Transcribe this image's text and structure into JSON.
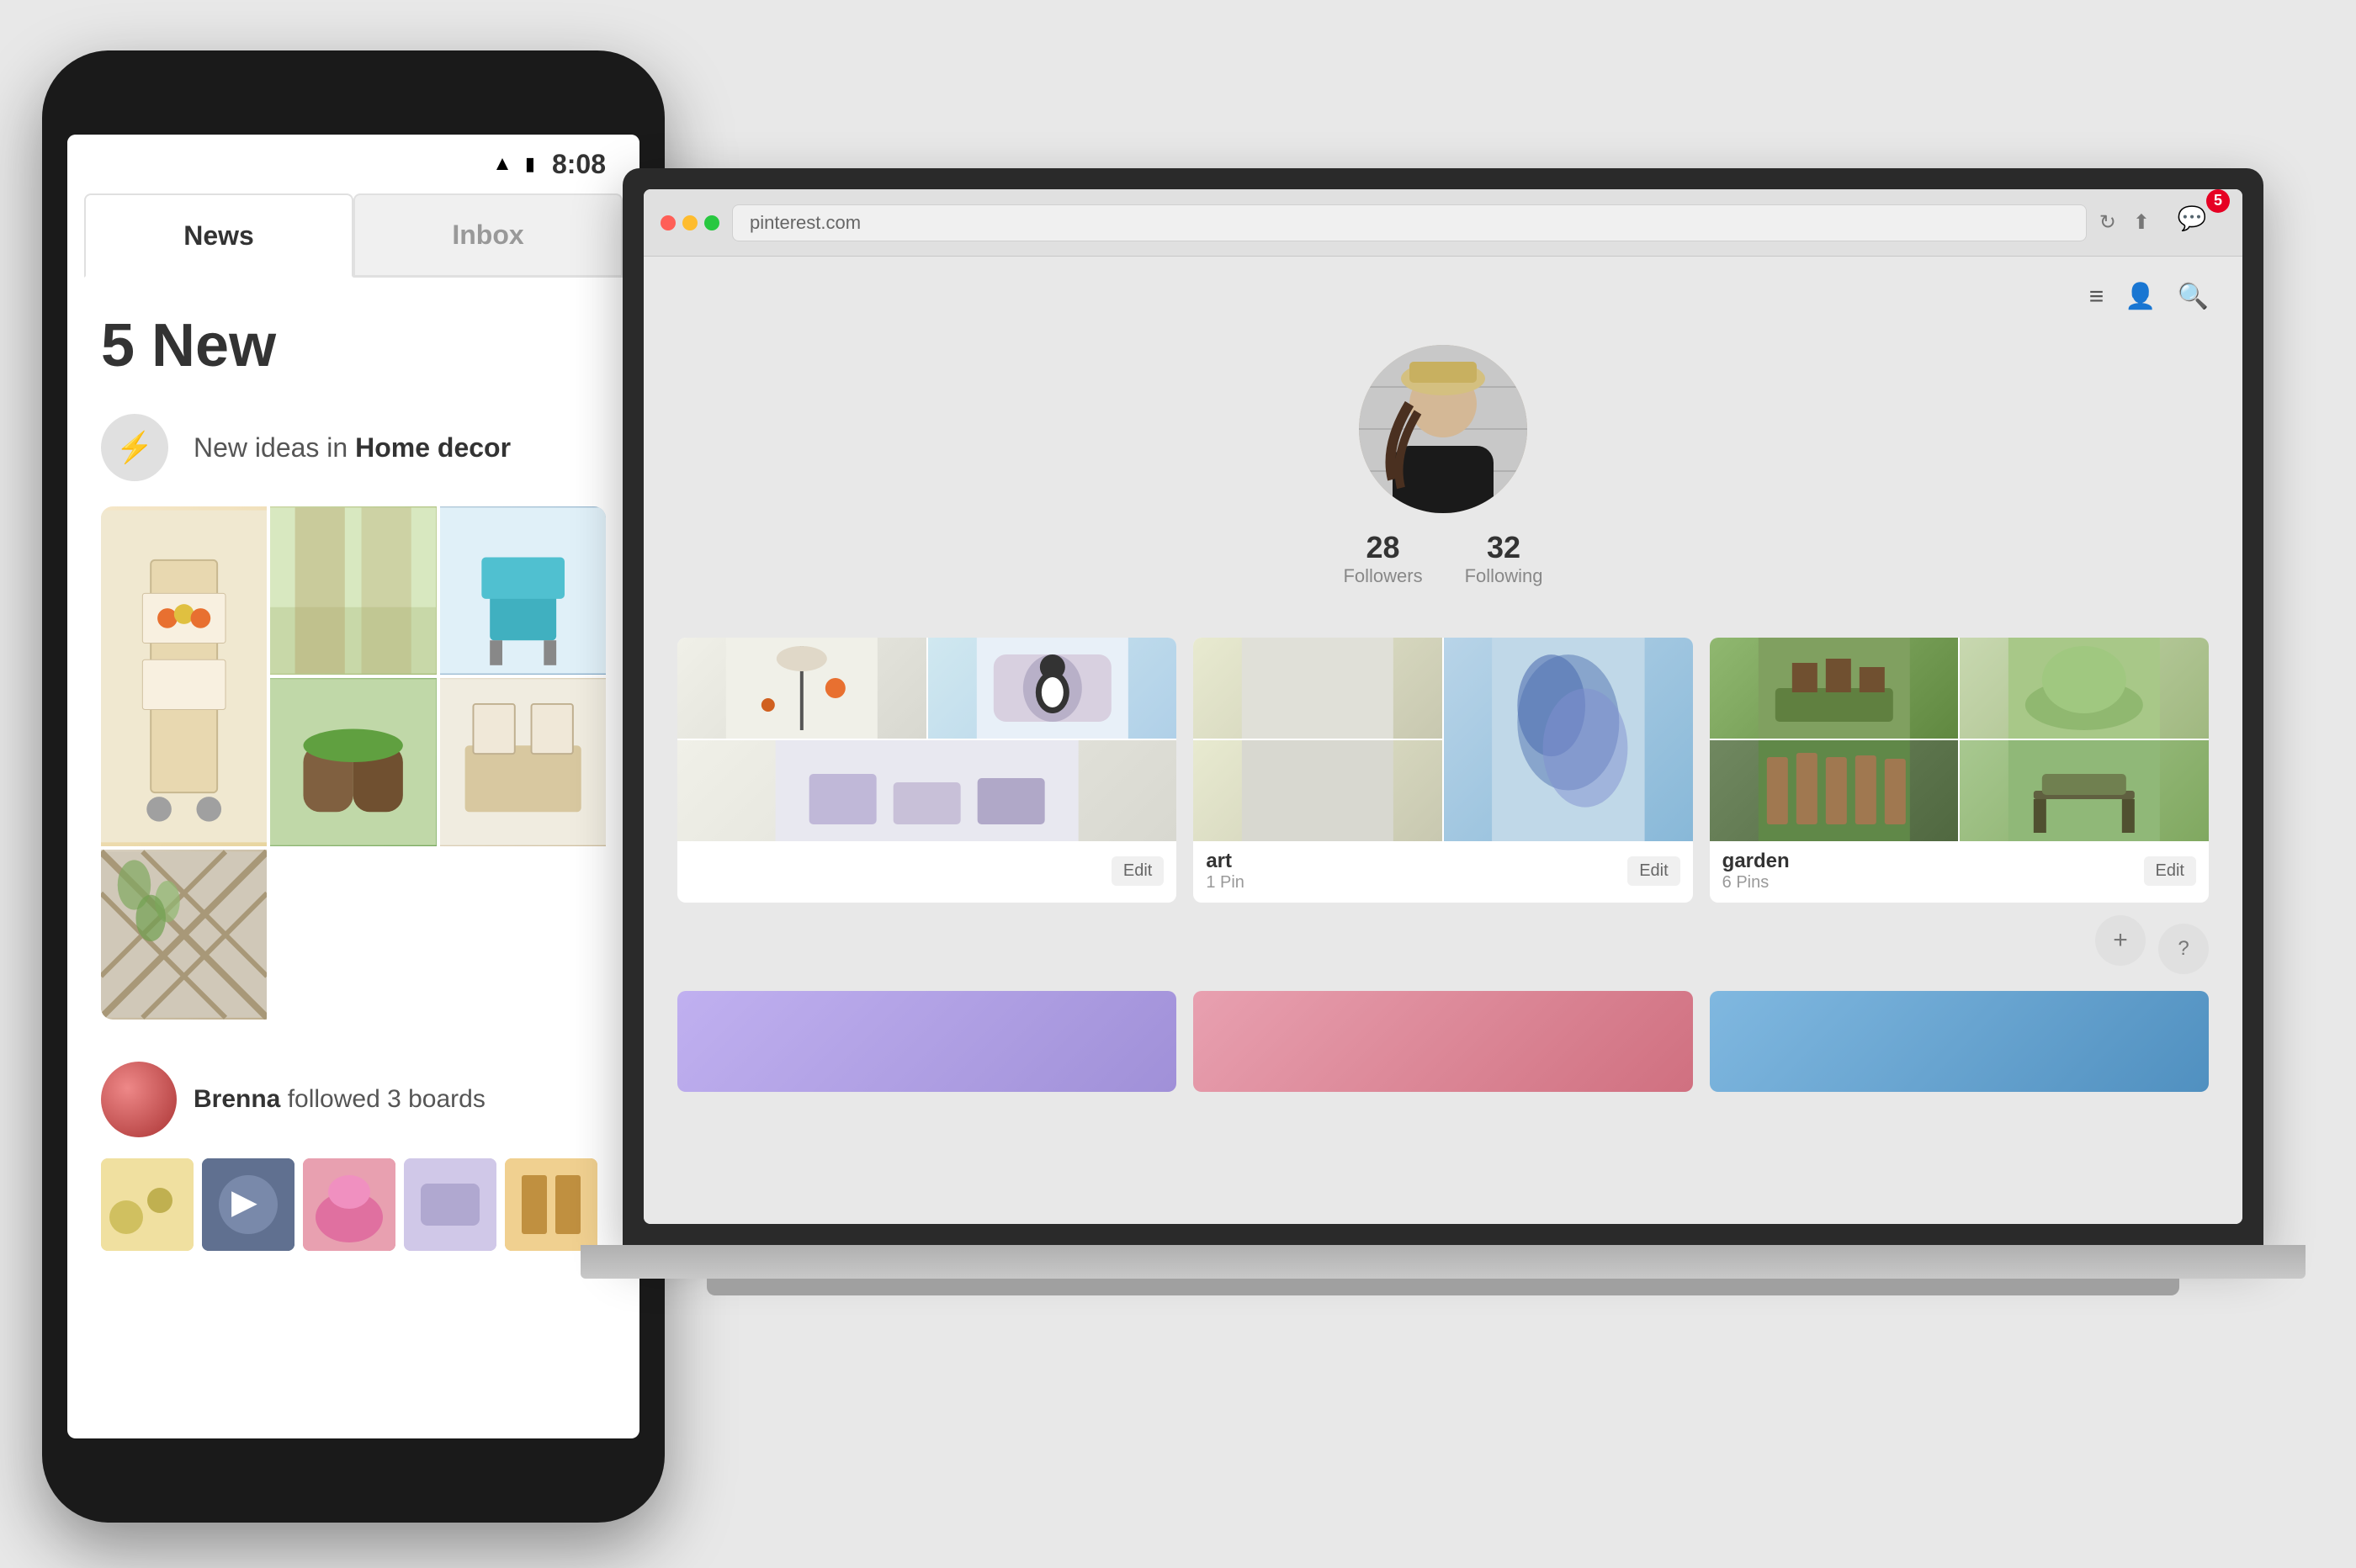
{
  "background_color": "#e8e8e8",
  "phone": {
    "status_bar": {
      "time": "8:08"
    },
    "tabs": [
      {
        "id": "news",
        "label": "News",
        "active": true
      },
      {
        "id": "inbox",
        "label": "Inbox",
        "active": false
      }
    ],
    "content": {
      "new_count": "5 New",
      "notification_1": {
        "icon": "⚡",
        "text_prefix": "New ideas in ",
        "text_bold": "Home decor"
      },
      "follower_item": {
        "name": "Brenna",
        "action": " followed 3 boards"
      }
    }
  },
  "laptop": {
    "browser": {
      "url": "pinterest.com",
      "notification_badge": "5"
    },
    "profile": {
      "followers_count": "28",
      "followers_label": "Followers",
      "following_count": "32",
      "following_label": "Following"
    },
    "boards": [
      {
        "id": "unnamed",
        "title": "",
        "pin_count": "",
        "edit_label": "Edit"
      },
      {
        "id": "art",
        "title": "art",
        "pin_count": "1 Pin",
        "edit_label": "Edit"
      },
      {
        "id": "garden",
        "title": "garden",
        "pin_count": "6 Pins",
        "edit_label": "Edit"
      }
    ],
    "buttons": {
      "add": "+",
      "help": "?"
    }
  }
}
